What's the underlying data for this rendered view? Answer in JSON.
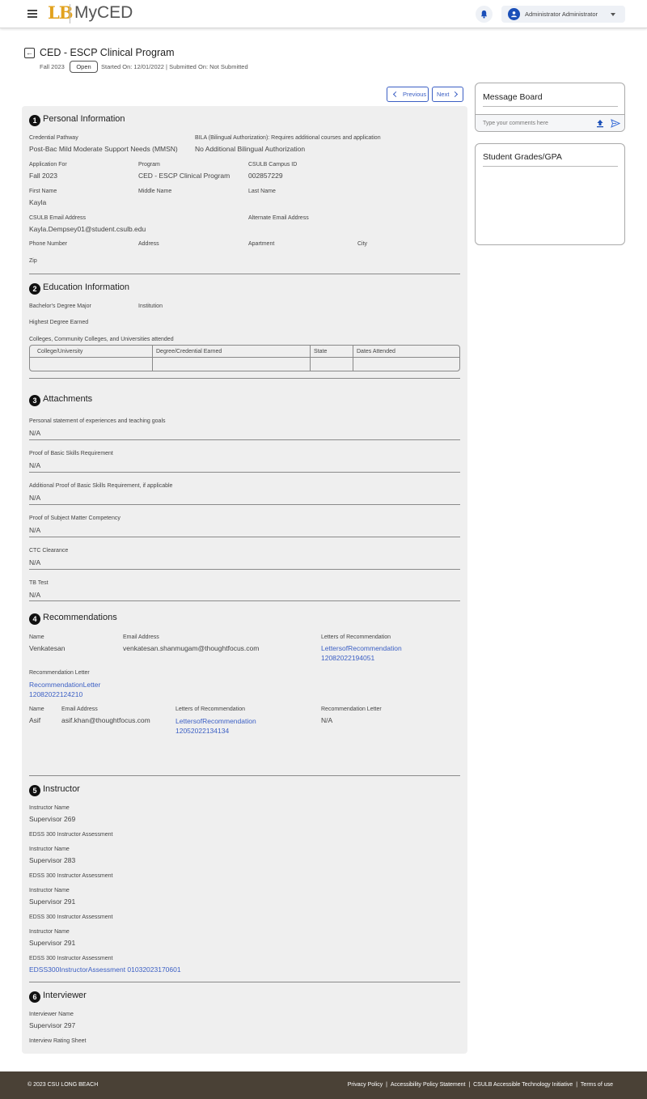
{
  "header": {
    "logo_mark": "LB",
    "app_name": "MyCED",
    "user_name": "Administrator Administrator"
  },
  "program": {
    "title": "CED - ESCP Clinical Program",
    "term": "Fall 2023",
    "status": "Open",
    "dates": "Started On: 12/01/2022 | Submitted On: Not Submitted"
  },
  "nav": {
    "previous": "Previous",
    "next": "Next"
  },
  "personal": {
    "num": "1",
    "title": "Personal Information",
    "credential_pathway_label": "Credential Pathway",
    "credential_pathway": "Post-Bac Mild Moderate Support Needs (MMSN)",
    "bila_label": "BILA (Bilingual Authorization): Requires additional courses and application",
    "bila": "No Additional Bilingual Authorization",
    "application_for_label": "Application For",
    "application_for": "Fall 2023",
    "program_label": "Program",
    "program": "CED - ESCP Clinical Program",
    "campus_id_label": "CSULB Campus ID",
    "campus_id": "002857229",
    "first_name_label": "First Name",
    "first_name": "Kayla",
    "middle_name_label": "Middle Name",
    "last_name_label": "Last Name",
    "email_label": "CSULB Email Address",
    "email": "Kayla.Dempsey01@student.csulb.edu",
    "alt_email_label": "Alternate Email Address",
    "phone_label": "Phone Number",
    "address_label": "Address",
    "apartment_label": "Apartment",
    "city_label": "City",
    "zip_label": "Zip"
  },
  "education": {
    "num": "2",
    "title": "Education Information",
    "major_label": "Bachelor's Degree Major",
    "institution_label": "Institution",
    "highest_label": "Highest Degree Earned",
    "colleges_label": "Colleges, Community Colleges, and Universities attended",
    "columns": [
      "College/University",
      "Degree/Credential Earned",
      "State",
      "Dates Attended"
    ]
  },
  "attachments": {
    "num": "3",
    "title": "Attachments",
    "items": [
      {
        "label": "Personal statement of experiences and teaching goals",
        "value": "N/A"
      },
      {
        "label": "Proof of Basic Skills Requirement",
        "value": "N/A"
      },
      {
        "label": "Additional Proof of Basic Skills Requirement, if applicable",
        "value": "N/A"
      },
      {
        "label": "Proof of Subject Matter Competency",
        "value": "N/A"
      },
      {
        "label": "CTC Clearance",
        "value": "N/A"
      },
      {
        "label": "TB Test",
        "value": "N/A"
      }
    ]
  },
  "recommendations": {
    "num": "4",
    "title": "Recommendations",
    "name_label": "Name",
    "email_label": "Email Address",
    "letters_label": "Letters of Recommendation",
    "rec_letter_label": "Recommendation Letter",
    "r1_name": "Venkatesan",
    "r1_email": "venkatesan.shanmugam@thoughtfocus.com",
    "r1_letters_1": "LettersofRecommendation",
    "r1_letters_2": "12082022194051",
    "r1_rec_1": "RecommendationLetter",
    "r1_rec_2": "12082022124210",
    "r2_name": "Asif",
    "r2_email": "asif.khan@thoughtfocus.com",
    "r2_letters_1": "LettersofRecommendation",
    "r2_letters_2": "12052022134134",
    "r2_rec": "N/A"
  },
  "instructor": {
    "num": "5",
    "title": "Instructor",
    "name_label": "Instructor Name",
    "assessment_label": "EDSS 300 Instructor Assessment",
    "names": [
      "Supervisor 269",
      "Supervisor 283",
      "Supervisor 291",
      "Supervisor 291"
    ],
    "assessment_link": "EDSS300InstructorAssessment 01032023170601"
  },
  "interviewer": {
    "num": "6",
    "title": "Interviewer",
    "name_label": "Interviewer Name",
    "name": "Supervisor 297",
    "rating_label": "Interview Rating Sheet"
  },
  "message_board": {
    "title": "Message Board",
    "placeholder": "Type your comments here"
  },
  "grades": {
    "title": "Student Grades/GPA"
  },
  "footer": {
    "copyright": "© 2023 CSU LONG BEACH",
    "links": [
      "Privacy Policy",
      "Accessibility Policy Statement",
      "CSULB Accessible Technology Initiative",
      "Terms of use"
    ]
  }
}
